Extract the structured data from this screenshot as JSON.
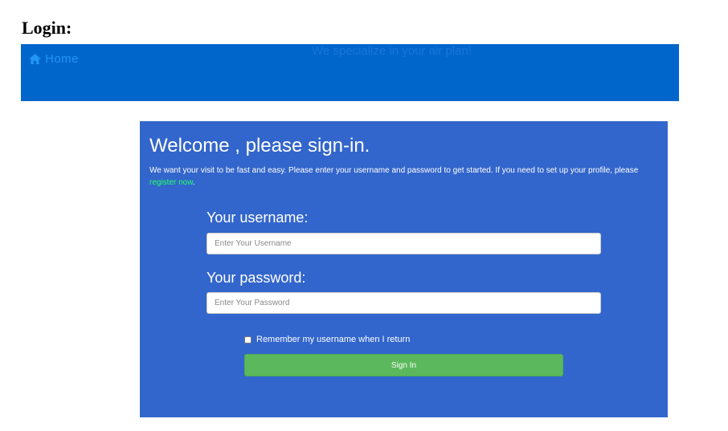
{
  "page": {
    "heading": "Login:"
  },
  "nav": {
    "home_label": "Home",
    "home_icon": "home-icon",
    "tagline": "We specialize in your air plan!",
    "bar_color": "#0066cc",
    "link_color": "#2196f3"
  },
  "login": {
    "title": "Welcome , please sign-in.",
    "intro_text": "We want your visit to be fast and easy. Please enter your username and password to get started. If you need to set up your profile, please ",
    "register_link": "register now",
    "intro_end": ".",
    "username_label": "Your username:",
    "username_placeholder": "Enter Your Username",
    "username_value": "",
    "password_label": "Your password:",
    "password_placeholder": "Enter Your Password",
    "password_value": "",
    "remember_label": "Remember my username when I return",
    "remember_checked": false,
    "signin_label": "Sign In",
    "panel_color": "#3366cc",
    "button_color": "#5cb85c",
    "link_color": "#22ff66"
  }
}
